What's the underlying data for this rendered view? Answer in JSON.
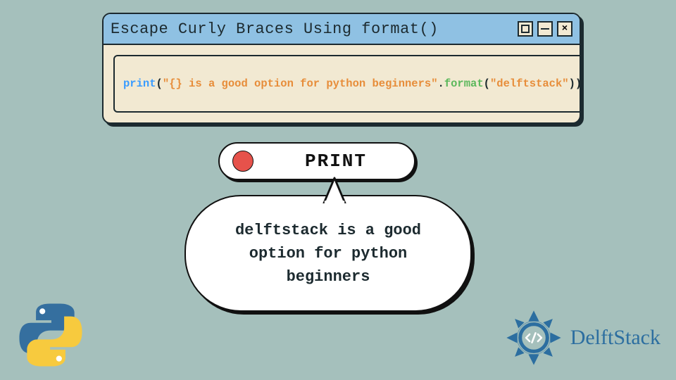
{
  "window": {
    "title": "Escape Curly Braces Using format()"
  },
  "code": {
    "func": "print",
    "open": "(",
    "str_q1": "\"",
    "str_body": "{} is a good option for python beginners",
    "str_q2": "\"",
    "dot": ".",
    "method": "format",
    "open2": "(",
    "arg_q1": "\"",
    "arg_body": "delftstack",
    "arg_q2": "\"",
    "close2": ")",
    "close": ")"
  },
  "print_button": {
    "label": "PRINT"
  },
  "output": {
    "text": "delftstack is a good option for python beginners"
  },
  "branding": {
    "delftstack": "DelftStack"
  }
}
